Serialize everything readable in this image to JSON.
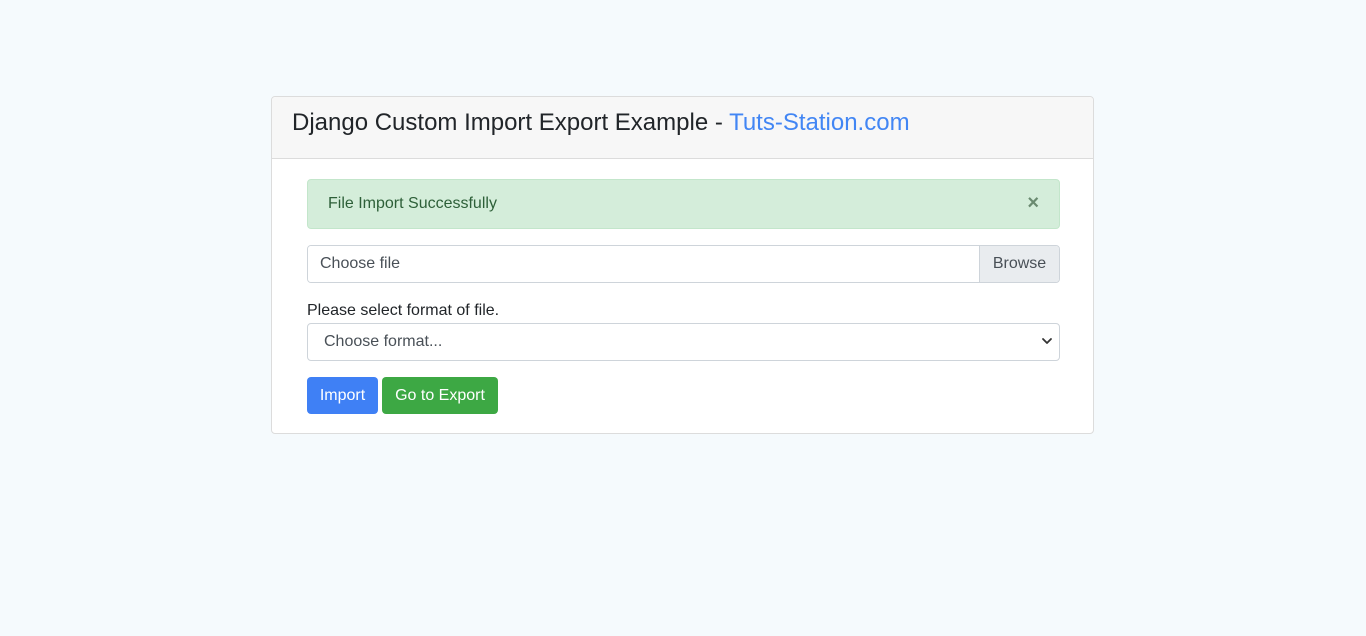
{
  "header": {
    "title_prefix": "Django Custom Import Export Example - ",
    "title_link": "Tuts-Station.com"
  },
  "alert": {
    "message": "File Import Successfully",
    "close_symbol": "×"
  },
  "file_input": {
    "placeholder": "Choose file",
    "browse_label": "Browse"
  },
  "format": {
    "label": "Please select format of file.",
    "selected": "Choose format..."
  },
  "buttons": {
    "import_label": "Import",
    "export_label": "Go to Export"
  },
  "colors": {
    "link": "#4286f4",
    "alert_bg": "#d4edda",
    "import_button": "#3f80f5",
    "export_button": "#3da844"
  }
}
